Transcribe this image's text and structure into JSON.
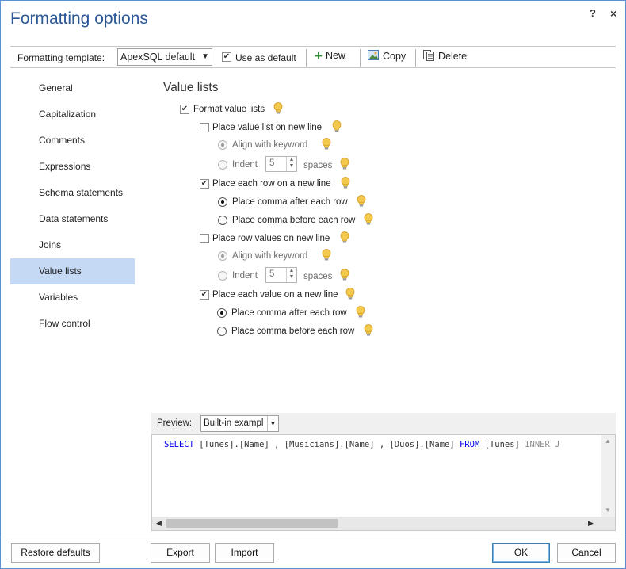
{
  "window": {
    "title": "Formatting options",
    "help_label": "?",
    "close_label": "×"
  },
  "toolbar": {
    "template_label": "Formatting template:",
    "template_value": "ApexSQL default",
    "use_as_default_label": "Use as default",
    "use_as_default_checked": true,
    "new_label": "New",
    "copy_label": "Copy",
    "delete_label": "Delete"
  },
  "nav": {
    "items": [
      {
        "label": "General"
      },
      {
        "label": "Capitalization"
      },
      {
        "label": "Comments"
      },
      {
        "label": "Expressions"
      },
      {
        "label": "Schema statements"
      },
      {
        "label": "Data statements"
      },
      {
        "label": "Joins"
      },
      {
        "label": "Value lists"
      },
      {
        "label": "Variables"
      },
      {
        "label": "Flow control"
      }
    ],
    "active": "Value lists"
  },
  "panel": {
    "title": "Value lists",
    "format_value_lists": "Format value lists",
    "place_value_list_new_line": "Place value list on new line",
    "align_with_keyword_1": "Align with keyword",
    "indent_1": "Indent",
    "indent_1_value": "5",
    "spaces_1": "spaces",
    "place_each_row_new_line": "Place each row on a new line",
    "comma_after_row_1": "Place comma after each row",
    "comma_before_row_1": "Place comma before each row",
    "place_row_values_new_line": "Place row values on new line",
    "align_with_keyword_2": "Align with keyword",
    "indent_2": "Indent",
    "indent_2_value": "5",
    "spaces_2": "spaces",
    "place_each_value_new_line": "Place each value on a new line",
    "comma_after_row_2": "Place comma after each row",
    "comma_before_row_2": "Place comma before each row"
  },
  "preview": {
    "label": "Preview:",
    "select_value": "Built-in exampl",
    "code": {
      "kw1": "SELECT",
      "t1": " [Tunes].[Name] , [Musicians].[Name] , [Duos].[Name] ",
      "kw2": "FROM",
      "t2": " [Tunes] ",
      "t3": "INNER J"
    }
  },
  "footer": {
    "restore_defaults": "Restore defaults",
    "export": "Export",
    "import": "Import",
    "ok": "OK",
    "cancel": "Cancel"
  },
  "colors": {
    "title": "#2b5797",
    "active_nav": "#c6d9f4",
    "keyword": "#0000ee",
    "window_border": "#5b8fce"
  },
  "icons": [
    "help-icon",
    "close-icon",
    "plus-icon",
    "copy-icon",
    "delete-icon",
    "lightbulb-icon",
    "dropdown-arrow-icon"
  ]
}
